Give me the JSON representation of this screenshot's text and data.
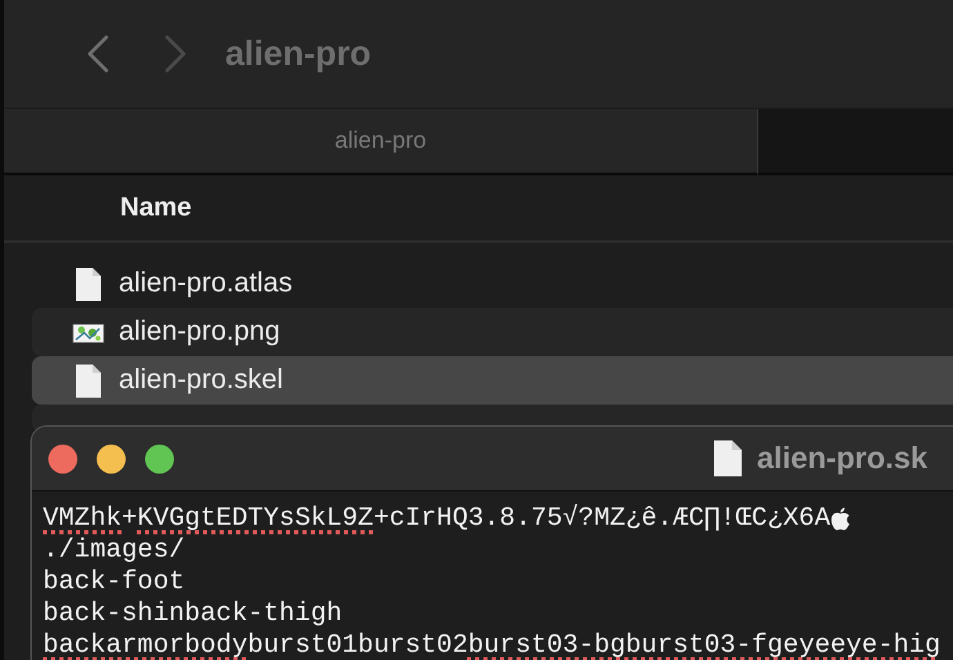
{
  "finder": {
    "title": "alien-pro",
    "nav": [
      {
        "kind": "back",
        "disabled": false
      },
      {
        "kind": "forward",
        "disabled": true
      }
    ],
    "tabs": [
      {
        "label": "alien-pro",
        "selected": true
      },
      {
        "selected": false
      }
    ],
    "columns": [
      "Name"
    ],
    "files": [
      {
        "name": "alien-pro.atlas",
        "kind": "document",
        "selected": false
      },
      {
        "name": "alien-pro.png",
        "kind": "image",
        "selected": false
      },
      {
        "name": "alien-pro.skel",
        "kind": "document",
        "selected": true
      }
    ]
  },
  "editor": {
    "title": "alien-pro.sk",
    "lines": [
      [
        {
          "text": "VMZhk",
          "misspelled": true
        },
        {
          "text": "+",
          "misspelled": false
        },
        {
          "text": "KVGgtEDTYsSkL9Z",
          "misspelled": true
        },
        {
          "text": "+cIrHQ3.8.75√?MZ¿ê.ÆC∏!ŒC¿X6A",
          "misspelled": false
        },
        {
          "kind": "apple"
        }
      ],
      [
        {
          "text": "./images/",
          "misspelled": false
        }
      ],
      [
        {
          "text": "back-foot",
          "misspelled": false
        }
      ],
      [
        {
          "text": "back-shinback-thigh",
          "misspelled": false
        }
      ],
      [
        {
          "text": "backarmorbody",
          "misspelled": true
        },
        {
          "text": "burst01burst02",
          "misspelled": false
        },
        {
          "text": "burst03-bgburst03-fgeyeeye-hig",
          "misspelled": true
        }
      ]
    ]
  }
}
